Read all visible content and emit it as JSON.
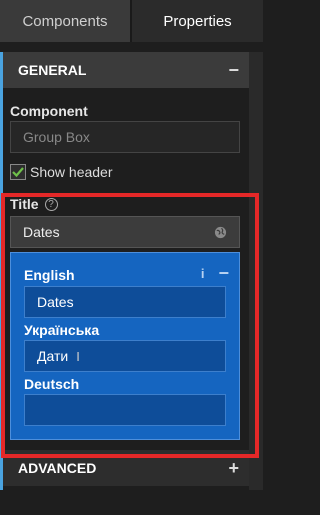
{
  "tabs": [
    {
      "label": "Components"
    },
    {
      "label": "Properties"
    }
  ],
  "general": {
    "header": "GENERAL",
    "toggle": "−",
    "component_label": "Component",
    "component_value": "Group Box",
    "show_header_label": "Show header",
    "show_header_checked": true,
    "title_label": "Title",
    "title_value": "Dates"
  },
  "translations": {
    "info_icon": "i",
    "collapse_icon": "−",
    "items": [
      {
        "language": "English",
        "value": "Dates"
      },
      {
        "language": "Українська",
        "value": "Дати"
      },
      {
        "language": "Deutsch",
        "value": ""
      }
    ]
  },
  "advanced": {
    "header": "ADVANCED",
    "toggle": "+"
  },
  "colors": {
    "accent": "#4aa3e0",
    "popup_bg": "#1565c0",
    "highlight": "#e52828"
  }
}
